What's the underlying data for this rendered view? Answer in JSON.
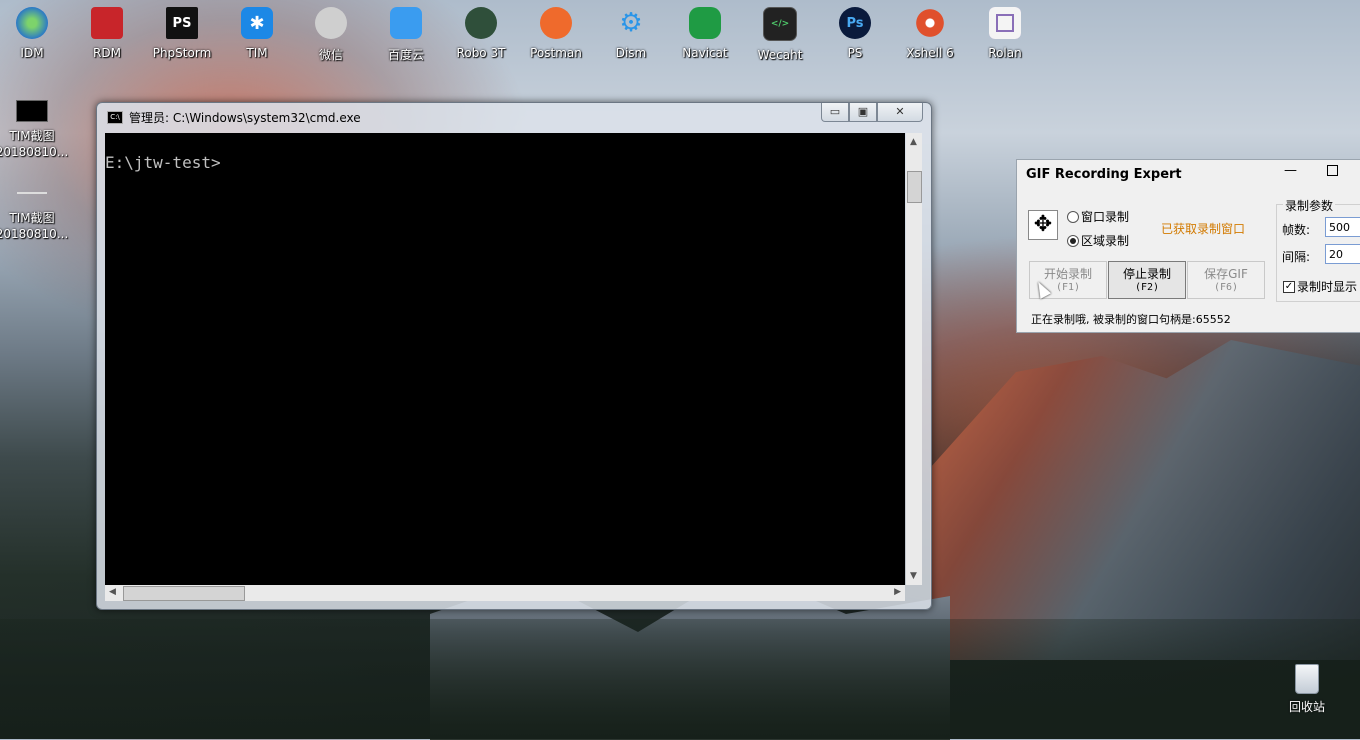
{
  "launcher": [
    {
      "label": "IDM",
      "icon": "idm-icon",
      "color": "#3a7ed0"
    },
    {
      "label": "RDM",
      "icon": "rdm-icon",
      "color": "#c8252a"
    },
    {
      "label": "PhpStorm",
      "icon": "phpstorm-icon",
      "color": "#222222",
      "glyph": "PS"
    },
    {
      "label": "TIM",
      "icon": "tim-icon",
      "color": "#1c88e6",
      "glyph": "✱"
    },
    {
      "label": "微信",
      "icon": "wechat-icon",
      "color": "#c9c9c9"
    },
    {
      "label": "百度云",
      "icon": "baidu-cloud-icon",
      "color": "#3a9cf0"
    },
    {
      "label": "Robo 3T",
      "icon": "robo3t-icon",
      "color": "#2f4f3a"
    },
    {
      "label": "Postman",
      "icon": "postman-icon",
      "color": "#ef6a2c"
    },
    {
      "label": "Dism",
      "icon": "dism-icon",
      "color": "#1c87d8",
      "glyph": "⚙"
    },
    {
      "label": "Navicat",
      "icon": "navicat-icon",
      "color": "#1f9b44"
    },
    {
      "label": "Wecaht",
      "icon": "wecaht-icon",
      "color": "#222222",
      "glyph": "</>"
    },
    {
      "label": "PS",
      "icon": "photoshop-icon",
      "color": "#0a1a3c",
      "glyph": "Ps"
    },
    {
      "label": "Xshell 6",
      "icon": "xshell-icon",
      "color": "#e0502c"
    },
    {
      "label": "Rolan",
      "icon": "rolan-icon",
      "color": "#f2f2f2"
    }
  ],
  "desktop": {
    "icon1": {
      "line1": "TIM截图",
      "line2": "20180810..."
    },
    "icon2": {
      "line1": "TIM截图",
      "line2": "20180810..."
    },
    "recycle_bin": "回收站"
  },
  "cmd": {
    "title": "管理员: C:\\Windows\\system32\\cmd.exe",
    "prompt": "E:\\jtw-test>",
    "min": "▭",
    "max": "▣",
    "close": "✕"
  },
  "gif": {
    "title": "GIF Recording Expert",
    "minimize": "—",
    "radio_window": "窗口录制",
    "radio_area": "区域录制",
    "got_window": "已获取录制窗口",
    "btn_start": "开始录制",
    "btn_start_key": "(F1)",
    "btn_stop": "停止录制",
    "btn_stop_key": "(F2)",
    "btn_save": "保存GIF",
    "btn_save_key": "(F6)",
    "status": "正在录制哦, 被录制的窗口句柄是:65552",
    "params_legend": "录制参数",
    "frames_label": "帧数:",
    "frames_value": "500",
    "interval_label": "间隔:",
    "interval_value": "20",
    "show_check": "录制时显示"
  }
}
